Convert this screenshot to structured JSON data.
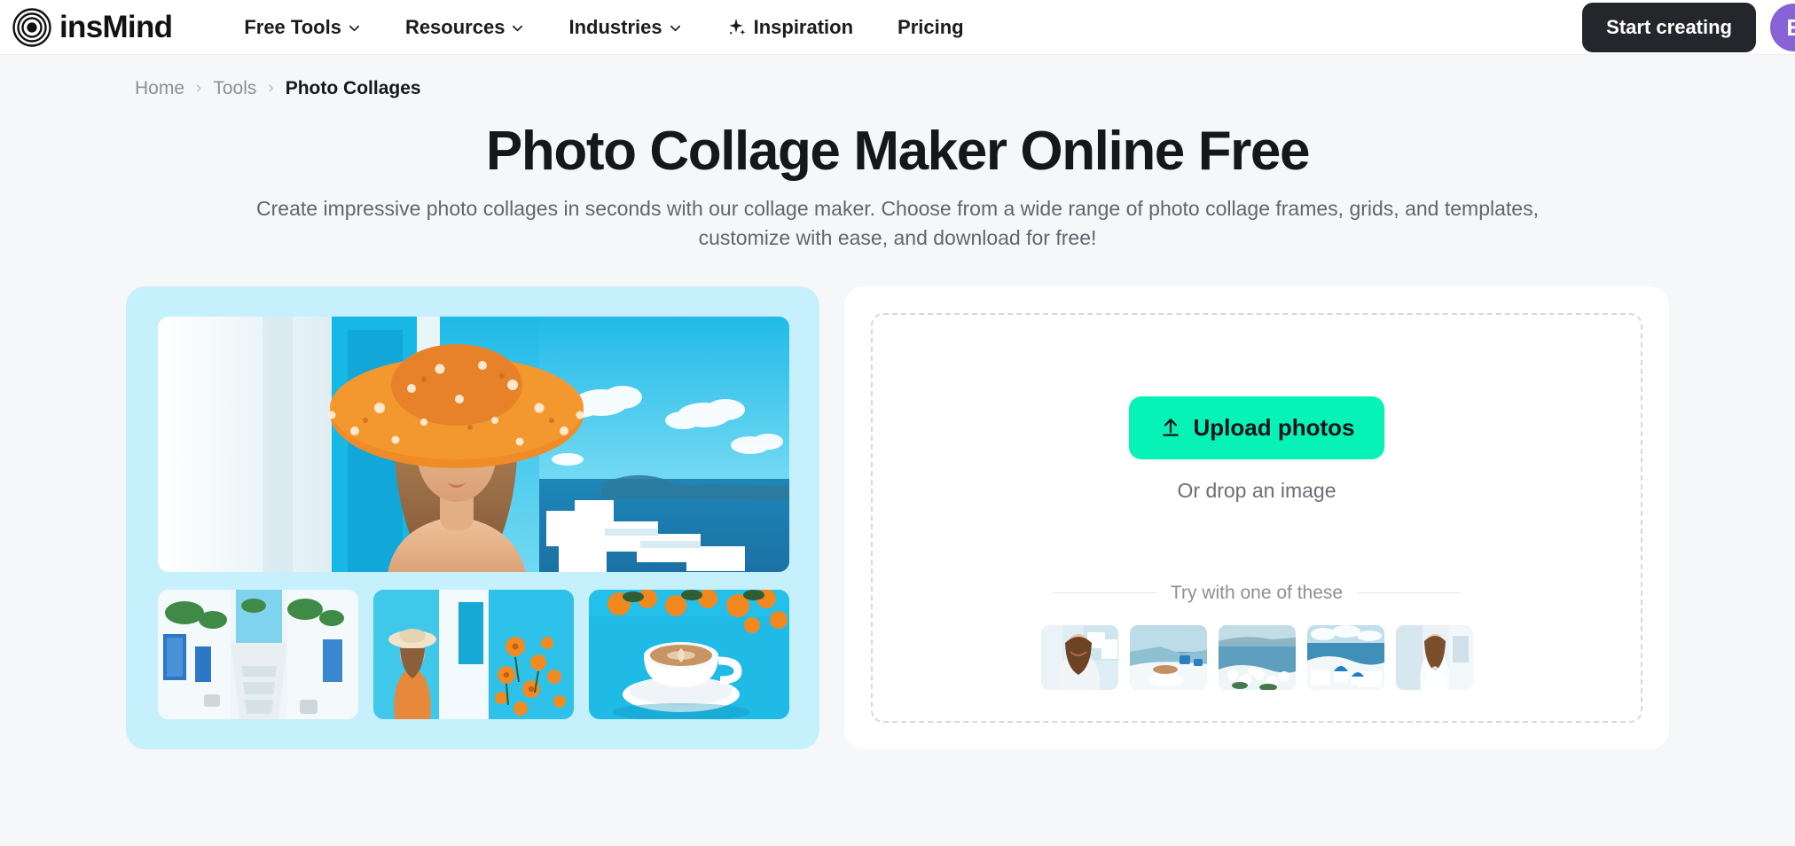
{
  "header": {
    "logo_text": "insMind",
    "logo_icon": "concentric-circles-logo-icon",
    "nav": [
      {
        "label": "Free Tools",
        "caret": true,
        "icon": null
      },
      {
        "label": "Resources",
        "caret": true,
        "icon": null
      },
      {
        "label": "Industries",
        "caret": true,
        "icon": null
      },
      {
        "label": "Inspiration",
        "caret": false,
        "icon": "sparkle-icon"
      },
      {
        "label": "Pricing",
        "caret": false,
        "icon": null
      }
    ],
    "start_button": "Start creating",
    "avatar_initial": "E",
    "avatar_color": "#8763d6"
  },
  "breadcrumb": {
    "home": "Home",
    "tools": "Tools",
    "current": "Photo Collages",
    "separator": "›"
  },
  "hero": {
    "title": "Photo Collage Maker Online Free",
    "subtitle": "Create impressive photo collages in seconds with our collage maker. Choose from a wide range of photo collage frames, grids, and templates, customize with ease, and download for free!"
  },
  "collage_preview": {
    "background_color": "#c6f0fb",
    "hero_photo_alt": "Woman in orange floral sun hat and sunglasses by blue Santorini wall with sea view",
    "thumbs": [
      "Whitewashed Greek alley with blue doors and potted plants",
      "Woman in orange dress beside blue wall with orange flowers",
      "Cappuccino cup on saucer with orange flowers on blue table"
    ]
  },
  "upload": {
    "button_label": "Upload photos",
    "button_color": "#07f2b6",
    "upload_icon": "upload-arrow-icon",
    "drop_hint": "Or drop an image",
    "divider_label": "Try with one of these",
    "samples": [
      "Woman smiling in white dress with Santorini village",
      "Coffee cup on ledge overlooking Aegean sea",
      "White flowers overlooking blue caldera water",
      "Blue domed churches above the sea",
      "Woman in white dress on white stairway"
    ]
  }
}
